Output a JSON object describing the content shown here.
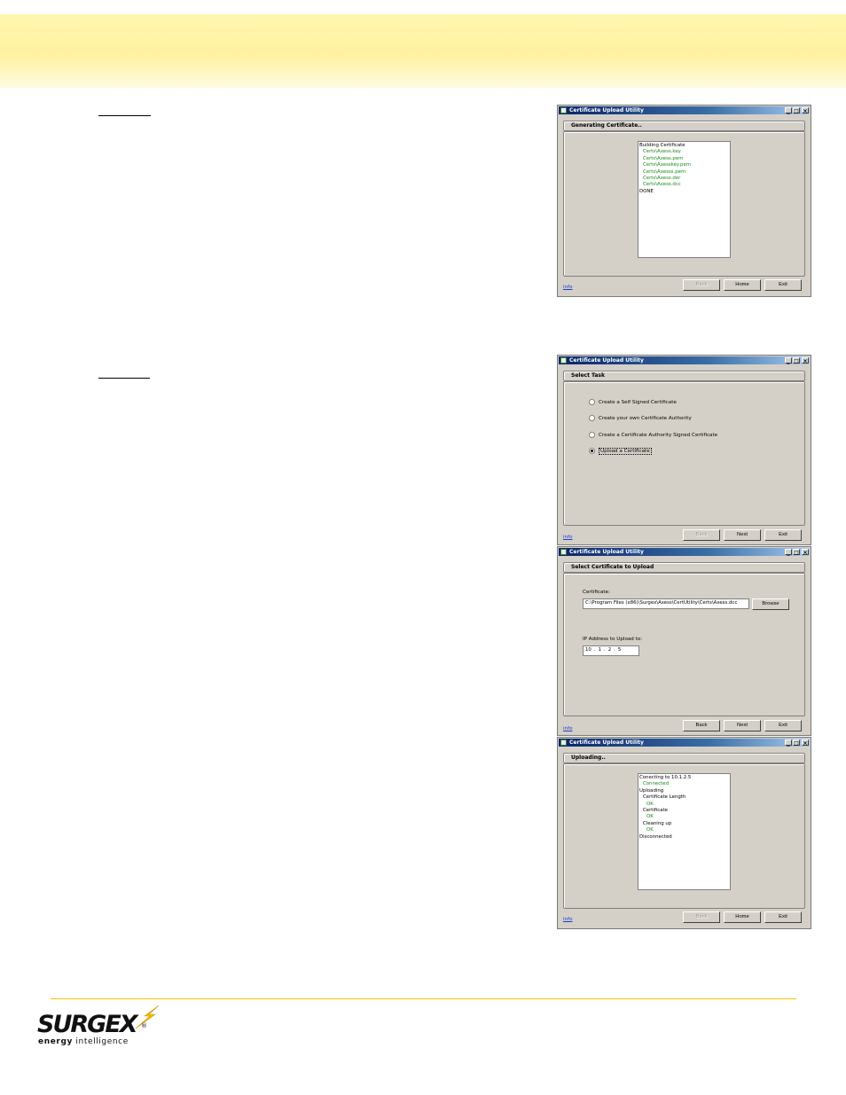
{
  "app_title": "Certificate Upload Utility",
  "window_controls": {
    "minimize": "_",
    "maximize": "□",
    "close": "×"
  },
  "info_link": "info",
  "buttons": {
    "back": "Back",
    "home": "Home",
    "exit": "Exit",
    "next": "Next",
    "browse": "Browse"
  },
  "windows": [
    {
      "group_title": "Generating Certificate..",
      "log": [
        {
          "text": "Building Certificate",
          "status": "normal"
        },
        {
          "text": "Certs\\Axess.key",
          "status": "ok"
        },
        {
          "text": "Certs\\Axess.pem",
          "status": "ok"
        },
        {
          "text": "Certs\\Axesskey.pem",
          "status": "ok"
        },
        {
          "text": "Certs\\Axesss.pem",
          "status": "ok"
        },
        {
          "text": "Certs\\Axess.der",
          "status": "ok"
        },
        {
          "text": "Certs\\Axess.dcc",
          "status": "ok"
        },
        {
          "text": "DONE",
          "status": "normal"
        }
      ]
    },
    {
      "group_title": "Select Task",
      "options": [
        {
          "label": "Create a Self Signed Certificate",
          "selected": false
        },
        {
          "label": "Create your own Certificate Authority",
          "selected": false
        },
        {
          "label": "Create a Certificate Authority Signed Certificate",
          "selected": false
        },
        {
          "label": "Upload a Certificate",
          "selected": true
        }
      ]
    },
    {
      "group_title": "Select Certificate to Upload",
      "certificate_label": "Certificate:",
      "certificate_path": "C:\\Program Files (x86)\\Surgex\\Axess\\CertUtility\\Certs\\Axess.dcc",
      "ip_label": "IP Address to Upload to:",
      "ip_octets": [
        "10",
        "1",
        "2",
        "5"
      ]
    },
    {
      "group_title": "Uploading..",
      "log": [
        {
          "text": "Conecting to 10.1.2.5",
          "status": "normal"
        },
        {
          "text": "Connected",
          "status": "ok"
        },
        {
          "text": "Uploading",
          "status": "normal"
        },
        {
          "text": "Certificate Length",
          "status": "normal"
        },
        {
          "text": "OK",
          "status": "ok"
        },
        {
          "text": "Certificate",
          "status": "normal"
        },
        {
          "text": "OK",
          "status": "ok"
        },
        {
          "text": "Cleaning up",
          "status": "normal"
        },
        {
          "text": "OK",
          "status": "ok"
        },
        {
          "text": "Disconnected",
          "status": "normal"
        }
      ]
    }
  ],
  "logo": {
    "wordmark": "SURGEX",
    "tagline_bold": "energy",
    "tagline_rest": " intelligence",
    "registered": "®"
  },
  "colors": {
    "header_band": "#fff3a8",
    "footer_rule": "#f2c200",
    "titlebar": "#0a246a",
    "ok_text": "#1a8a1a",
    "link": "#1a3acc"
  }
}
